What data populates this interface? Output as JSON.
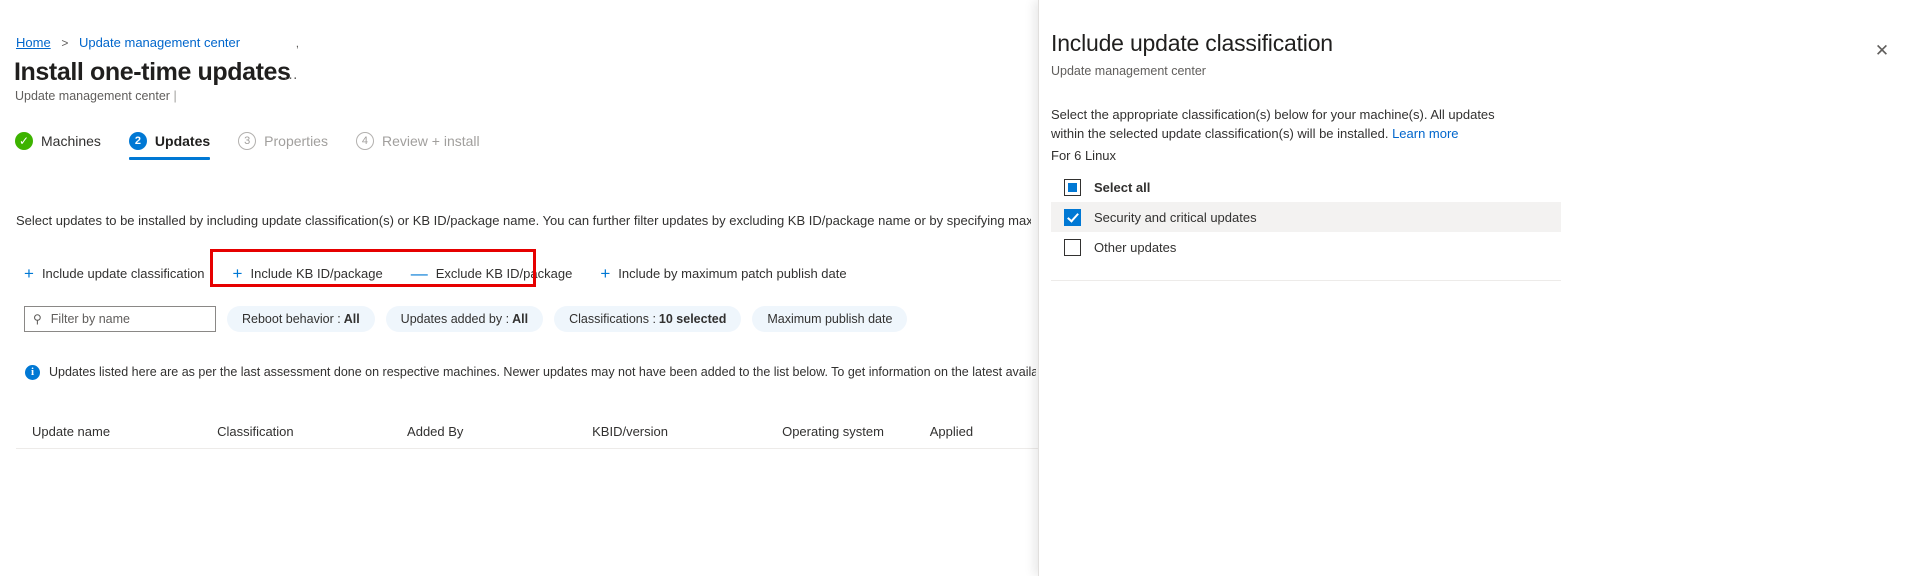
{
  "breadcrumb": {
    "home": "Home",
    "separator": ">",
    "current": "Update management center",
    "trailing": ","
  },
  "header": {
    "title": "Install one-time updates",
    "ellipsis": "…",
    "subtitle": "Update management center",
    "subtitle_tail": " |"
  },
  "tabs": [
    {
      "label": "Machines",
      "badge": "✓",
      "state": "done"
    },
    {
      "label": "Updates",
      "badge": "2",
      "state": "active"
    },
    {
      "label": "Properties",
      "badge": "3",
      "state": "todo"
    },
    {
      "label": "Review + install",
      "badge": "4",
      "state": "todo"
    }
  ],
  "instructions": "Select updates to be installed by including update classification(s) or KB ID/package name. You can further filter updates by excluding KB ID/package name or by specifying maximum patch pu",
  "commands": [
    {
      "label": "Include update classification",
      "glyph": "+",
      "kind": "plus"
    },
    {
      "label": "Include KB ID/package",
      "glyph": "+",
      "kind": "plus"
    },
    {
      "label": "Exclude KB ID/package",
      "glyph": "—",
      "kind": "minus"
    },
    {
      "label": "Include by maximum patch publish date",
      "glyph": "+",
      "kind": "plus"
    }
  ],
  "highlight_color": "#e60000",
  "filters": {
    "search_placeholder": "Filter by name",
    "search_value": "",
    "search_icon": "⚲",
    "chips": [
      {
        "label": "Reboot behavior : ",
        "value": "All"
      },
      {
        "label": "Updates added by : ",
        "value": "All"
      },
      {
        "label": "Classifications : ",
        "value": "10 selected"
      },
      {
        "label": "Maximum publish date",
        "value": ""
      }
    ]
  },
  "info_bar": {
    "icon": "i",
    "text": "Updates listed here are as per the last assessment done on respective machines. Newer updates may not have been added to the list below. To get information on the latest available updates, we recomm"
  },
  "table": {
    "columns": [
      "Update name",
      "Classification",
      "Added By",
      "KBID/version",
      "Operating system",
      "Applied"
    ],
    "rows": []
  },
  "panel": {
    "title": "Include update classification",
    "subtitle": "Update management center",
    "close_icon": "✕",
    "description": "Select the appropriate classification(s) below for your machine(s). All updates within the selected update classification(s) will be installed. ",
    "learn_more": "Learn more",
    "group_label": "For 6 Linux",
    "options": [
      {
        "label": "Select all",
        "state": "indeterminate",
        "selected": false,
        "is_head": true
      },
      {
        "label": "Security and critical updates",
        "state": "checked",
        "selected": true,
        "is_head": false
      },
      {
        "label": "Other updates",
        "state": "unchecked",
        "selected": false,
        "is_head": false
      }
    ]
  },
  "colors": {
    "accent": "#0078d4",
    "link": "#0066cc",
    "success": "#3db300",
    "highlight": "#e60000",
    "chip_bg": "#eff6fc"
  }
}
